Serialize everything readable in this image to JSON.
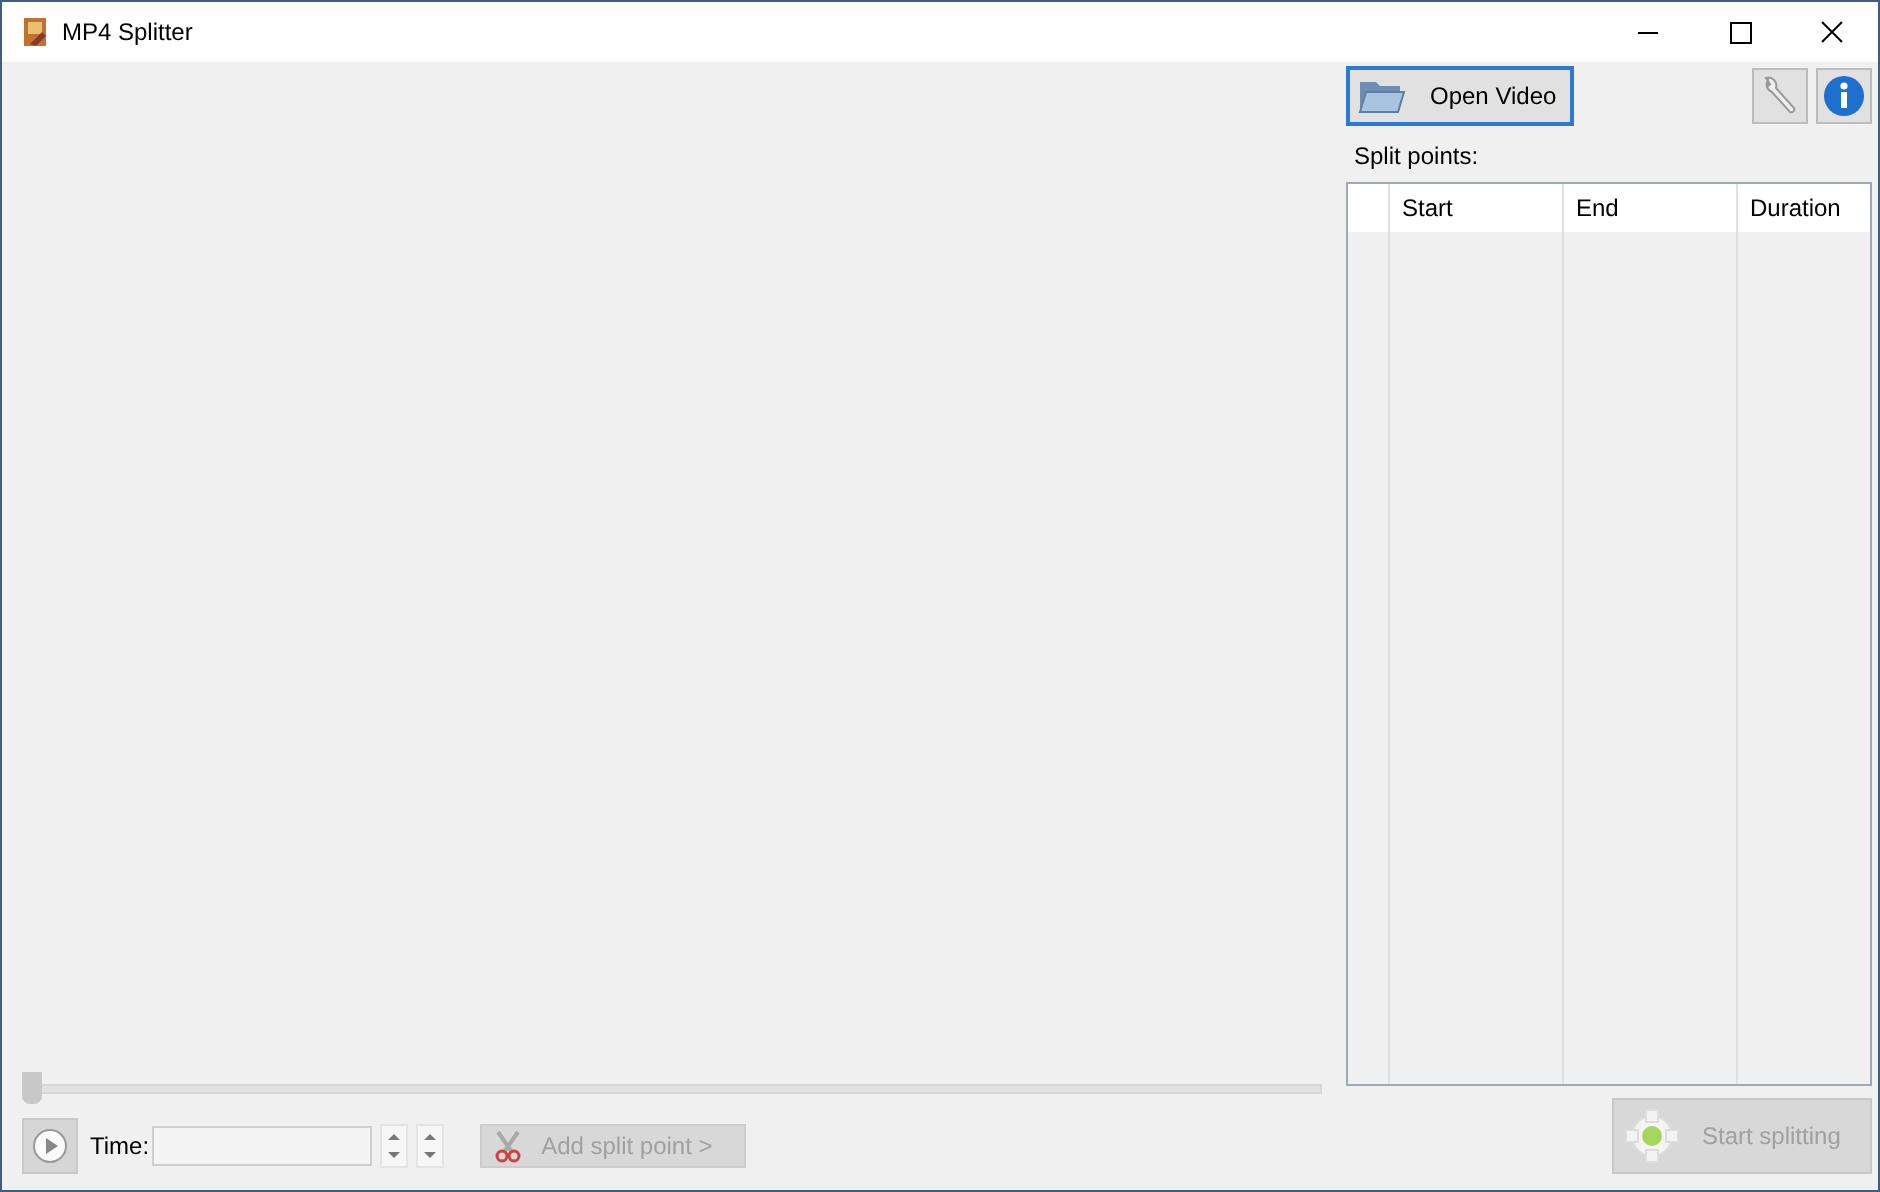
{
  "window": {
    "title": "MP4 Splitter"
  },
  "toolbar": {
    "open_button": "Open Video"
  },
  "split_points": {
    "label": "Split points:",
    "columns": [
      "Start",
      "End",
      "Duration"
    ]
  },
  "seek_slider": {
    "level": 0
  },
  "time_field": {
    "label": "Time:"
  },
  "add_button": {
    "label": "Add split point >",
    "disabled": true
  },
  "start_button": {
    "label": "Start splitting",
    "disabled": true
  }
}
